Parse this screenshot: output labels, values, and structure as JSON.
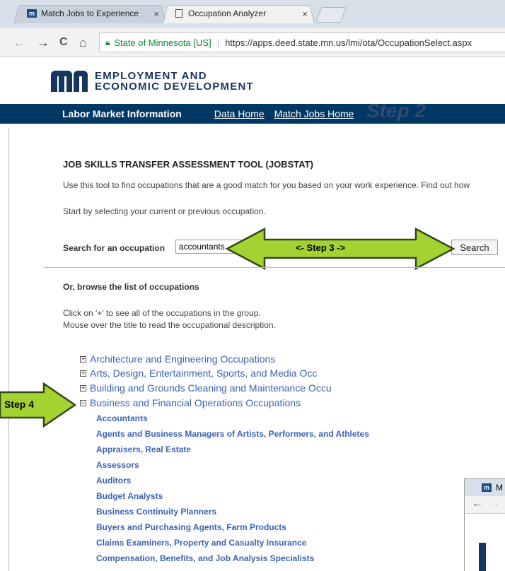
{
  "browser": {
    "tabs": [
      {
        "favicon": "mn",
        "title": "Match Jobs to Experience",
        "close": "×",
        "active": false
      },
      {
        "favicon": "document-icon",
        "title": "Occupation Analyzer",
        "close": "×",
        "active": true
      }
    ],
    "nav": {
      "back": "←",
      "forward": "→",
      "reload": "C",
      "home": "⌂"
    },
    "address": {
      "security_label": "State of Minnesota [US]",
      "url": "https://apps.deed.state.mn.us/lmi/ota/OccupationSelect.aspx"
    }
  },
  "header": {
    "logo_line1": "EMPLOYMENT AND",
    "logo_line2": "ECONOMIC DEVELOPMENT",
    "bar_title": "Labor Market Information",
    "links": [
      "Data Home",
      "Match Jobs Home"
    ]
  },
  "main": {
    "title": "JOB SKILLS TRANSFER ASSESSMENT TOOL (JOBSTAT)",
    "intro": "Use this tool to find occupations that are a good match for you based on your work experience. Find out how",
    "start": "Start by selecting your current or previous occupation.",
    "search_label": "Search for an occupation",
    "search_value": "accountants",
    "search_button": "Search",
    "browse_heading": "Or, browse the list of occupations",
    "help1": "Click on '+' to see all of the occupations in the group.",
    "help2": "Mouse over the title to read the occupational description.",
    "categories": [
      {
        "sign": "+",
        "label": "Architecture and Engineering Occupations"
      },
      {
        "sign": "+",
        "label": "Arts, Design, Entertainment, Sports, and Media Occ"
      },
      {
        "sign": "+",
        "label": "Building and Grounds Cleaning and Maintenance Occu"
      },
      {
        "sign": "−",
        "label": "Business and Financial Operations Occupations"
      }
    ],
    "occupations": [
      "Accountants",
      "Agents and Business Managers of Artists, Performers, and Athletes",
      "Appraisers, Real Estate",
      "Assessors",
      "Auditors",
      "Budget Analysts",
      "Business Continuity Planners",
      "Buyers and Purchasing Agents, Farm Products",
      "Claims Examiners, Property and Casualty Insurance",
      "Compensation, Benefits, and Job Analysis Specialists"
    ]
  },
  "annotations": {
    "step2": "Step 2",
    "step3": "<-   Step 3   ->",
    "step4": "Step 4",
    "callout_color": "#a4d233"
  },
  "popup": {
    "tab_favicon": "mn",
    "tab_text": "M"
  }
}
